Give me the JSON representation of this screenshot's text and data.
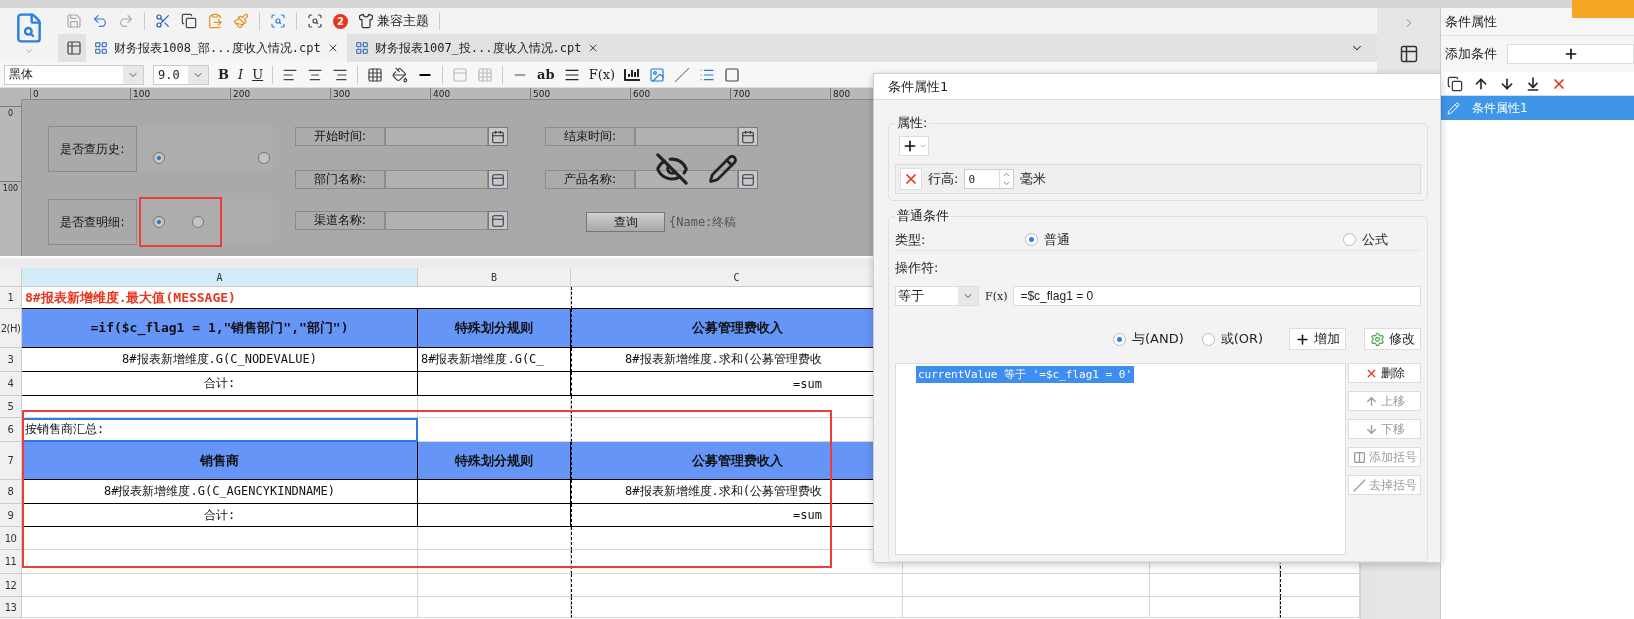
{
  "toolbar": {
    "badge": "2",
    "theme_label": "兼容主题"
  },
  "tabs": [
    {
      "label": "财务报表1008_部...度收入情况.cpt",
      "selected": true
    },
    {
      "label": "财务报表1007_投...度收入情况.cpt",
      "selected": false
    }
  ],
  "format_bar": {
    "font": "黑体",
    "size": "9.0",
    "bold": "B",
    "italic": "I",
    "underline": "U",
    "text_tool": "ab",
    "formula_tool": "F(x)"
  },
  "rulers": {
    "horizontal": [
      "0",
      "100",
      "200",
      "300",
      "400",
      "500",
      "600",
      "700",
      "800"
    ],
    "vertical": [
      "0",
      "100"
    ]
  },
  "form": {
    "radio_groups": [
      {
        "label": "是否查历史:",
        "options": [
          {
            "selected": true
          },
          {
            "selected": false
          }
        ]
      },
      {
        "label": "是否查明细:",
        "options": [
          {
            "selected": true
          },
          {
            "selected": false
          }
        ]
      }
    ],
    "fields": [
      {
        "label": "开始时间:",
        "kind": "date"
      },
      {
        "label": "部门名称:",
        "kind": "select"
      },
      {
        "label": "渠道名称:",
        "kind": "select"
      },
      {
        "label": "结束时间:",
        "kind": "date"
      },
      {
        "label": "产品名称:",
        "kind": "select"
      }
    ],
    "query_button": "查询",
    "name_tag": "{Name:终稿"
  },
  "sheet": {
    "columns": [
      {
        "label": "A",
        "selected": true
      },
      {
        "label": "B",
        "selected": false
      },
      {
        "label": "C",
        "selected": false
      }
    ],
    "rows": [
      {
        "label": "1",
        "kind": "title",
        "cells": [
          {
            "text": "8#报表新增维度.最大值(MESSAGE)",
            "selected": false
          },
          {
            "selected": false
          }
        ]
      },
      {
        "label": "2(H)",
        "kind": "header",
        "cells": [
          {
            "text": "=if($c_flag1 = 1,\"销售部门\",\"部门\")",
            "selected": false
          },
          {
            "text": "特殊划分规则",
            "selected": false
          },
          {
            "text": "公募管理费收入",
            "selected": false
          }
        ]
      },
      {
        "label": "3",
        "kind": "body",
        "cells": [
          {
            "text": "8#报表新增维度.G(C_NODEVALUE)",
            "selected": false
          },
          {
            "text": "8#报表新增维度.G(C_",
            "selected": false
          },
          {
            "text": "8#报表新增维度.求和(公募管理费收",
            "selected": false
          }
        ]
      },
      {
        "label": "4",
        "kind": "body",
        "cells": [
          {
            "text": "合计:",
            "selected": false
          },
          {
            "selected": false
          },
          {
            "text": "=sum",
            "selected": false
          }
        ]
      },
      {
        "label": "5",
        "kind": "plain",
        "cells": [
          {
            "selected": false
          },
          {
            "selected": false
          },
          {
            "selected": false
          }
        ]
      },
      {
        "label": "6",
        "kind": "plain",
        "cells": [
          {
            "text": "按销售商汇总:",
            "selected": true
          },
          {
            "selected": false
          },
          {
            "selected": false
          }
        ]
      },
      {
        "label": "7",
        "kind": "header",
        "cells": [
          {
            "text": "销售商",
            "selected": false
          },
          {
            "text": "特殊划分规则",
            "selected": false
          },
          {
            "text": "公募管理费收入",
            "selected": false
          }
        ]
      },
      {
        "label": "8",
        "kind": "body",
        "cells": [
          {
            "text": "8#报表新增维度.G(C_AGENCYKINDNAME)",
            "selected": false
          },
          {
            "selected": false
          },
          {
            "text": "8#报表新增维度.求和(公募管理费收",
            "selected": false
          }
        ]
      },
      {
        "label": "9",
        "kind": "body",
        "cells": [
          {
            "text": "合计:",
            "selected": false
          },
          {
            "selected": false
          },
          {
            "text": "=sum",
            "selected": false
          }
        ]
      },
      {
        "label": "10",
        "kind": "plain",
        "cells": [
          {
            "selected": false
          },
          {
            "selected": false
          },
          {
            "selected": false
          }
        ]
      },
      {
        "label": "11",
        "kind": "plain",
        "cells": [
          {
            "selected": false
          },
          {
            "selected": false
          },
          {
            "selected": false
          }
        ]
      },
      {
        "label": "12",
        "kind": "plain",
        "cells": [
          {
            "selected": false
          },
          {
            "selected": false
          },
          {
            "selected": false
          }
        ]
      },
      {
        "label": "13",
        "kind": "plain",
        "cells": [
          {
            "selected": false
          },
          {
            "selected": false
          },
          {
            "selected": false
          }
        ]
      }
    ]
  },
  "dialog": {
    "title": "条件属性1",
    "property_group": {
      "legend": "属性:",
      "row_label": "行高:",
      "value": "0",
      "unit": "毫米"
    },
    "condition_group": {
      "legend": "普通条件",
      "type_label": "类型:",
      "types": [
        {
          "label": "普通",
          "selected": true
        },
        {
          "label": "公式",
          "selected": false
        }
      ],
      "operator_label": "操作符:",
      "operator": "等于",
      "fx_label": "F(x)",
      "formula": "=$c_flag1 = 0",
      "joins": [
        {
          "label": "与(AND)",
          "selected": true
        },
        {
          "label": "或(OR)",
          "selected": false
        }
      ],
      "add_button": "增加",
      "edit_button": "修改",
      "conditions": [
        {
          "text": "currentValue 等于 '=$c_flag1 = 0'",
          "selected": true
        }
      ],
      "side_buttons": [
        {
          "label": "删除",
          "kind": "delete",
          "disabled": false
        },
        {
          "label": "上移",
          "kind": "up",
          "disabled": true
        },
        {
          "label": "下移",
          "kind": "down",
          "disabled": true
        },
        {
          "label": "添加括号",
          "kind": "add_bracket",
          "disabled": true
        },
        {
          "label": "去掉括号",
          "kind": "remove_bracket",
          "disabled": true
        }
      ]
    }
  },
  "side_panel": {
    "title": "条件属性",
    "add_label": "添加条件",
    "items": [
      {
        "label": "条件属性1",
        "selected": true
      }
    ]
  }
}
